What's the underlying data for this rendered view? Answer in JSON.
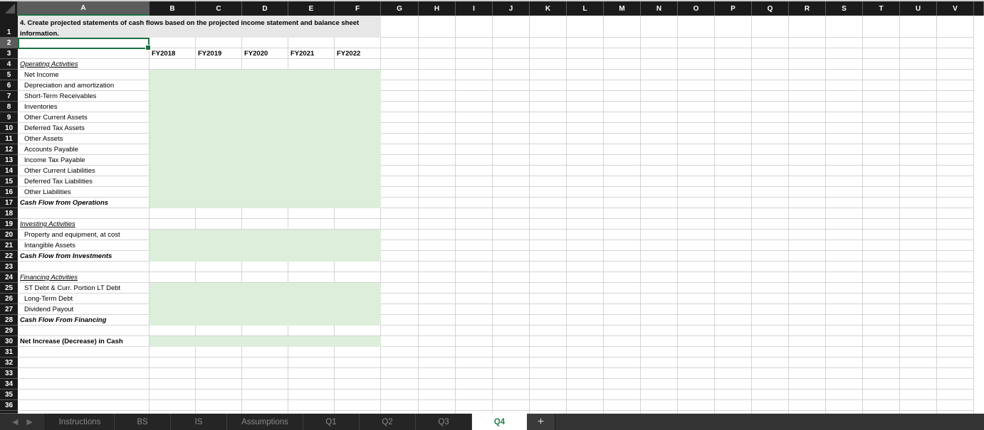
{
  "sheet": {
    "columns": [
      "A",
      "B",
      "C",
      "D",
      "E",
      "F",
      "G",
      "H",
      "I",
      "J",
      "K",
      "L",
      "M",
      "N",
      "O",
      "P",
      "Q",
      "R",
      "S",
      "T",
      "U",
      "V"
    ],
    "selected_column": "A",
    "selected_cell": "A2",
    "row_numbers": [
      "1",
      "2",
      "3",
      "4",
      "5",
      "6",
      "7",
      "8",
      "9",
      "10",
      "11",
      "12",
      "13",
      "14",
      "15",
      "16",
      "17",
      "18",
      "19",
      "20",
      "21",
      "22",
      "23",
      "24",
      "25",
      "26",
      "27",
      "28",
      "29",
      "30",
      "31",
      "32",
      "33",
      "34",
      "35",
      "36"
    ],
    "title": "4. Create projected statements of cash flows based on the projected income statement and balance sheet information.",
    "year_headers": [
      "FY2018",
      "FY2019",
      "FY2020",
      "FY2021",
      "FY2022"
    ],
    "input_fill_color": "#ddefdb",
    "rows": [
      {
        "row": 4,
        "label": "Operating Activities",
        "style": "section"
      },
      {
        "row": 5,
        "label": "Net Income",
        "style": "item",
        "input": true
      },
      {
        "row": 6,
        "label": "Depreciation and amortization",
        "style": "item",
        "input": true
      },
      {
        "row": 7,
        "label": "Short-Term Receivables",
        "style": "item",
        "input": true
      },
      {
        "row": 8,
        "label": "Inventories",
        "style": "item",
        "input": true
      },
      {
        "row": 9,
        "label": "Other Current Assets",
        "style": "item",
        "input": true
      },
      {
        "row": 10,
        "label": "Deferred Tax Assets",
        "style": "item",
        "input": true
      },
      {
        "row": 11,
        "label": "Other Assets",
        "style": "item",
        "input": true
      },
      {
        "row": 12,
        "label": "Accounts Payable",
        "style": "item",
        "input": true
      },
      {
        "row": 13,
        "label": "Income Tax Payable",
        "style": "item",
        "input": true
      },
      {
        "row": 14,
        "label": "Other Current Liabilities",
        "style": "item",
        "input": true
      },
      {
        "row": 15,
        "label": "Deferred Tax Liabilities",
        "style": "item",
        "input": true
      },
      {
        "row": 16,
        "label": "Other Liabilities",
        "style": "item",
        "input": true
      },
      {
        "row": 17,
        "label": "Cash Flow from Operations",
        "style": "total",
        "input": true
      },
      {
        "row": 19,
        "label": "Investing Activities",
        "style": "section"
      },
      {
        "row": 20,
        "label": "Property and equipment, at cost",
        "style": "item",
        "input": true
      },
      {
        "row": 21,
        "label": "Intangible Assets",
        "style": "item",
        "input": true
      },
      {
        "row": 22,
        "label": "Cash Flow from Investments",
        "style": "total",
        "input": true
      },
      {
        "row": 24,
        "label": "Financing Activities",
        "style": "section"
      },
      {
        "row": 25,
        "label": "ST Debt & Curr. Portion LT Debt",
        "style": "item",
        "input": true
      },
      {
        "row": 26,
        "label": "Long-Term Debt",
        "style": "item",
        "input": true
      },
      {
        "row": 27,
        "label": "Dividend Payout",
        "style": "item",
        "input": true
      },
      {
        "row": 28,
        "label": "Cash Flow From Financing",
        "style": "total",
        "input": true
      },
      {
        "row": 30,
        "label": "Net Increase (Decrease) in Cash",
        "style": "bold",
        "input": true
      }
    ]
  },
  "tabs": {
    "nav_prev_icon": "◀",
    "nav_next_icon": "▶",
    "items": [
      {
        "label": "Instructions",
        "active": false
      },
      {
        "label": "BS",
        "active": false
      },
      {
        "label": "IS",
        "active": false
      },
      {
        "label": "Assumptions",
        "active": false
      },
      {
        "label": "Q1",
        "active": false
      },
      {
        "label": "Q2",
        "active": false
      },
      {
        "label": "Q3",
        "active": false
      },
      {
        "label": "Q4",
        "active": true
      }
    ],
    "add_label": "+",
    "active_color": "#1e8449"
  }
}
